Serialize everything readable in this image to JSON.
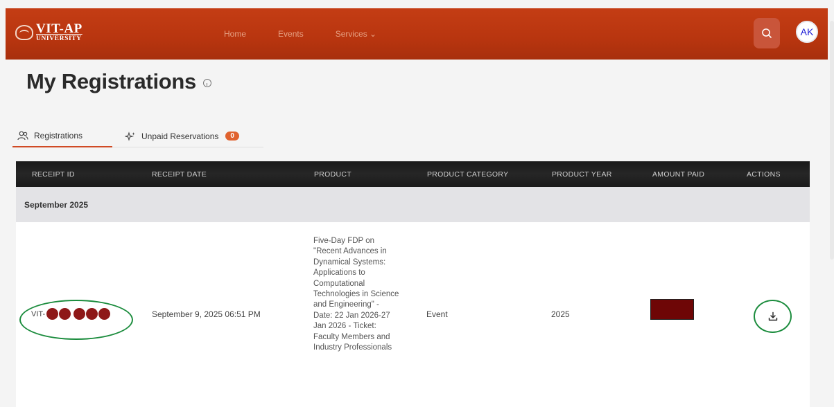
{
  "header": {
    "logo_main": "VIT-AP",
    "logo_sub": "UNIVERSITY",
    "nav": [
      {
        "label": "Home"
      },
      {
        "label": "Events"
      },
      {
        "label": "Services ⌄"
      }
    ],
    "avatar_initials": "AK",
    "brand_color": "#b8350f"
  },
  "page": {
    "title": "My Registrations"
  },
  "tabs": [
    {
      "label": "Registrations",
      "icon": "users-icon",
      "active": true
    },
    {
      "label": "Unpaid Reservations",
      "icon": "sparkle-icon",
      "badge": "0",
      "active": false
    }
  ],
  "table": {
    "columns": [
      "RECEIPT ID",
      "RECEIPT DATE",
      "PRODUCT",
      "PRODUCT CATEGORY",
      "PRODUCT YEAR",
      "AMOUNT PAID",
      "ACTIONS"
    ],
    "group_label": "September 2025",
    "rows": [
      {
        "receipt_id_prefix": "VIT-",
        "receipt_date": "September 9, 2025 06:51 PM",
        "product": "Five-Day FDP on \"Recent Advances in Dynamical Systems: Applications to Computational Technologies in Science and Engineering\" - Date: 22 Jan 2026-27 Jan 2026 - Ticket: Faculty Members and Industry Professionals",
        "product_category": "Event",
        "product_year": "2025"
      }
    ]
  }
}
